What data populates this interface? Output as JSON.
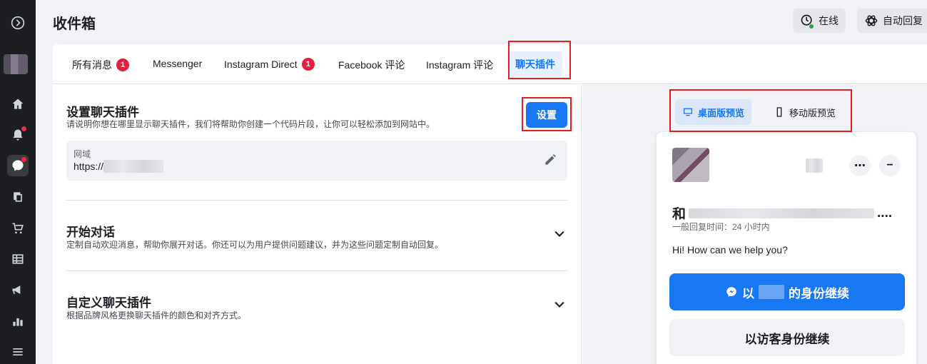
{
  "header": {
    "title": "收件箱",
    "status_label": "在线",
    "auto_reply_label": "自动回复"
  },
  "tabs": [
    {
      "label": "所有消息",
      "badge": "1"
    },
    {
      "label": "Messenger"
    },
    {
      "label": "Instagram Direct",
      "badge": "1"
    },
    {
      "label": "Facebook 评论"
    },
    {
      "label": "Instagram 评论"
    },
    {
      "label": "聊天插件",
      "active": true
    }
  ],
  "setup": {
    "title": "设置聊天插件",
    "desc": "请说明你想在哪里显示聊天插件，我们将帮助你创建一个代码片段，让你可以轻松添加到网站中。",
    "button": "设置",
    "domain_label": "网域",
    "domain_value": "https://"
  },
  "start": {
    "title": "开始对话",
    "desc": "定制自动欢迎消息，帮助你展开对话。你还可以为用户提供问题建议，并为这些问题定制自动回复。"
  },
  "customize": {
    "title": "自定义聊天插件",
    "desc": "根据品牌风格更换聊天插件的颜色和对齐方式。"
  },
  "preview": {
    "desktop_label": "桌面版预览",
    "mobile_label": "移动版预览",
    "name_prefix": "和",
    "name_suffix": "....",
    "reply_time": "一般回复时间：24 小时内",
    "greeting": "Hi! How can we help you?",
    "continue_prefix": "以",
    "continue_suffix": "的身份继续",
    "guest_label": "以访客身份继续"
  },
  "colors": {
    "accent": "#1877f2",
    "badge": "#e41e3f",
    "online": "#31a24c",
    "annotation": "#e41e1e"
  }
}
